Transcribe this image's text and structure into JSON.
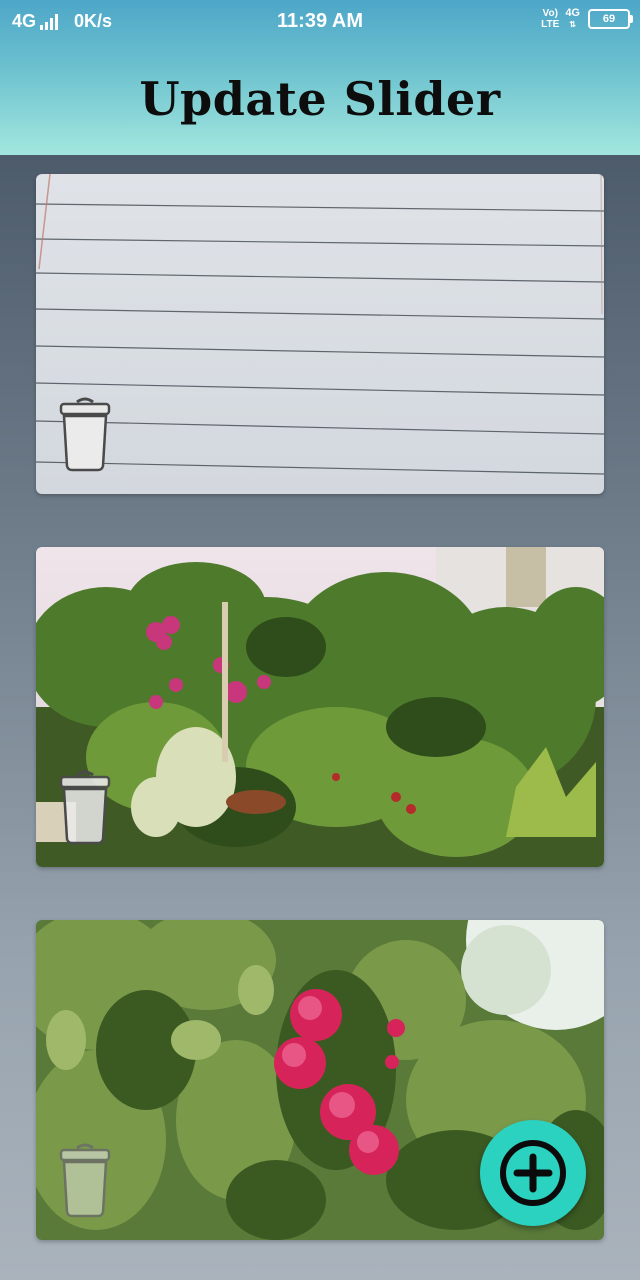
{
  "status_bar": {
    "network": "4G",
    "speed": "0K/s",
    "time": "11:39 AM",
    "volte": "Vo)",
    "lte": "LTE",
    "net_right": "4G",
    "battery": "69"
  },
  "header": {
    "title": "Update Slider"
  },
  "slides": [
    {
      "image": "lined-paper-photo",
      "delete_icon": "trash-icon"
    },
    {
      "image": "potted-plants-photo",
      "delete_icon": "trash-icon"
    },
    {
      "image": "pink-roses-photo",
      "delete_icon": "trash-icon"
    }
  ],
  "fab": {
    "icon": "plus-circle-icon"
  },
  "colors": {
    "header_top": "#4da6c8",
    "header_bottom": "#a2e7de",
    "fab": "#2ad2bf"
  }
}
